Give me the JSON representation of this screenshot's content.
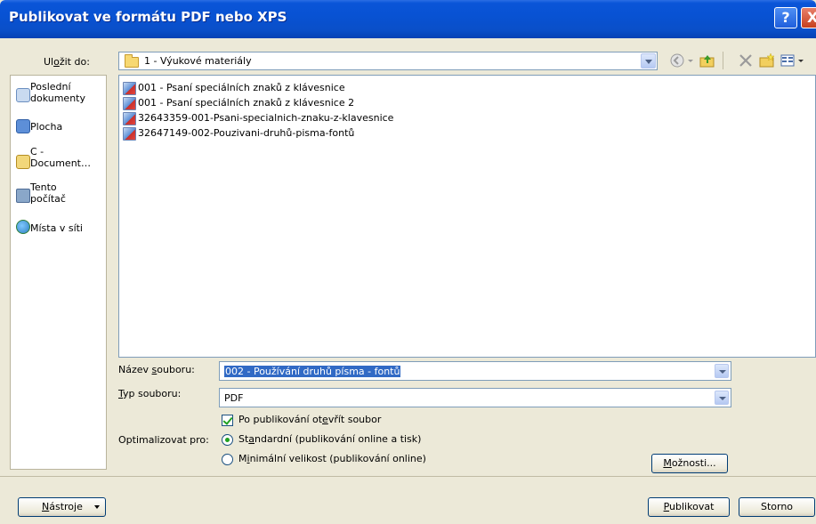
{
  "window": {
    "title": "Publikovat ve formátu PDF nebo XPS",
    "help_label": "?",
    "close_label": "X"
  },
  "save_in": {
    "label_pre": "Ul",
    "label_accel": "o",
    "label_post": "žit do:",
    "folder": "1 - Výukové materiály"
  },
  "places": [
    {
      "label": "Poslední dokumenty",
      "icon": "recent-documents-icon",
      "color": "#7aa6d6"
    },
    {
      "label": "Plocha",
      "icon": "desktop-icon",
      "color": "#5d8fd8"
    },
    {
      "label": "C - Document…",
      "icon": "folder-icon",
      "color": "#f2d77a"
    },
    {
      "label": "Tento počítač",
      "icon": "computer-icon",
      "color": "#8aa7c9"
    },
    {
      "label": "Místa v síti",
      "icon": "network-icon",
      "color": "#4f9b4a"
    }
  ],
  "files": [
    {
      "name": "001 - Psaní speciálních znaků z klávesnice"
    },
    {
      "name": "001 - Psaní speciálních znaků z klávesnice 2"
    },
    {
      "name": "32643359-001-Psani-specialnich-znaku-z-klavesnice"
    },
    {
      "name": "32647149-002-Pouzivani-druhů-pisma-fontů"
    }
  ],
  "filename": {
    "label_pre": "Název ",
    "label_accel": "s",
    "label_post": "ouboru:",
    "value": "002 - Používání druhů písma - fontů"
  },
  "filetype": {
    "label_accel": "T",
    "label_post": "yp souboru:",
    "value": "PDF"
  },
  "open_after": {
    "pre": "Po publikování ot",
    "accel": "e",
    "post": "vřít soubor",
    "checked": true
  },
  "optimize": {
    "label": "Optimalizovat pro:",
    "options": [
      {
        "pre": "St",
        "accel": "a",
        "post": "ndardní (publikování online a tisk)",
        "selected": true
      },
      {
        "pre": "M",
        "accel": "i",
        "post": "nimální velikost (publikování online)",
        "selected": false
      }
    ]
  },
  "buttons": {
    "options": {
      "accel": "M",
      "post": "ožnosti..."
    },
    "tools": {
      "accel": "N",
      "post": "ástroje"
    },
    "publish": {
      "accel": "P",
      "post": "ublikovat"
    },
    "cancel": "Storno"
  }
}
